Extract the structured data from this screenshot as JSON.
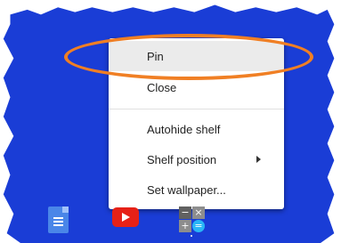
{
  "context_menu": {
    "items": [
      {
        "label": "Pin"
      },
      {
        "label": "Close"
      },
      {
        "label": "Autohide shelf"
      },
      {
        "label": "Shelf position"
      },
      {
        "label": "Set wallpaper..."
      }
    ]
  },
  "shelf": {
    "apps": [
      {
        "icon": "google-docs-icon"
      },
      {
        "icon": "youtube-icon"
      },
      {
        "icon": "calculator-icon"
      }
    ]
  },
  "colors": {
    "desktop": "#1a3dd6",
    "highlight_oval": "#f07f24",
    "menu_hover": "#ebebeb"
  }
}
